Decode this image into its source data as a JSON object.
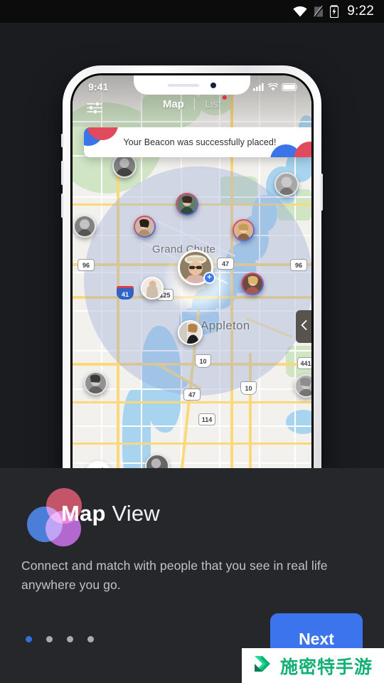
{
  "android_status": {
    "time": "9:22",
    "icons": [
      "wifi-icon",
      "sim-off-icon",
      "battery-charging-icon"
    ]
  },
  "phone": {
    "ios_status": {
      "time": "9:41",
      "icons": [
        "cellular-bars-icon",
        "wifi-icon",
        "battery-icon"
      ]
    },
    "topnav": {
      "filter_icon": "sliders-icon",
      "tabs": [
        {
          "label": "Map",
          "active": true,
          "badge": false
        },
        {
          "label": "List",
          "active": false,
          "badge": true
        }
      ]
    },
    "toast": {
      "message": "Your Beacon was successfully placed!"
    },
    "map": {
      "places": [
        {
          "label": "Grand Chute"
        },
        {
          "label": "Appleton"
        }
      ],
      "shields": [
        {
          "label": "96"
        },
        {
          "label": "96"
        },
        {
          "label": "47"
        },
        {
          "label": "41"
        },
        {
          "label": "125"
        },
        {
          "label": "10"
        },
        {
          "label": "10"
        },
        {
          "label": "441"
        },
        {
          "label": "47"
        },
        {
          "label": "114"
        }
      ],
      "locate_icon": "navigation-arrow-icon",
      "drawer_icon": "chevron-left-icon",
      "me_badge": "+"
    }
  },
  "content": {
    "title_bold": "Map",
    "title_light": "View",
    "description": "Connect and match with people that you see in real life anywhere you go.",
    "dots": [
      {
        "active": true
      },
      {
        "active": false
      },
      {
        "active": false
      },
      {
        "active": false
      }
    ],
    "next_label": "Next"
  },
  "watermark": {
    "text": "施密特手游",
    "icon": "green-chevron-logo"
  },
  "colors": {
    "accent_blue": "#3b74ec",
    "logo_red": "#c8394f",
    "logo_blue": "#2f6fe0",
    "logo_purple": "#b353d6",
    "badge_red": "#f0293e",
    "watermark_green": "#12b072",
    "bg_top": "#1b1c20",
    "bg_bottom": "#26272b"
  }
}
